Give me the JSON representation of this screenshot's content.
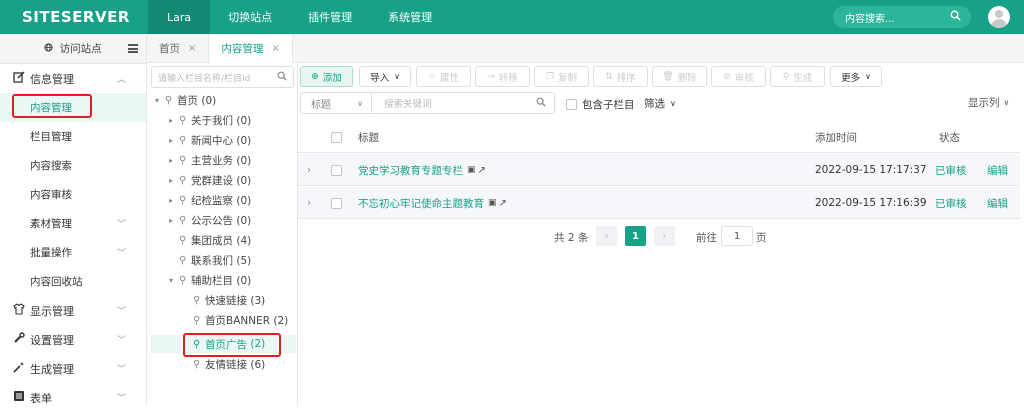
{
  "brand": {
    "logo_text": "SITESERVER"
  },
  "topnav": {
    "items": [
      "Lara",
      "切换站点",
      "插件管理",
      "系统管理"
    ],
    "search_placeholder": "内容搜索..."
  },
  "sidebar": {
    "visit_site": "访问站点",
    "groups": [
      {
        "label": "信息管理",
        "icon": "edit-icon",
        "expanded": true
      },
      {
        "label": "显示管理",
        "icon": "shirt-icon"
      },
      {
        "label": "设置管理",
        "icon": "wrench-icon"
      },
      {
        "label": "生成管理",
        "icon": "magic-wand-icon"
      },
      {
        "label": "表单",
        "icon": "list-icon"
      }
    ],
    "sub_items": [
      "内容管理",
      "栏目管理",
      "内容搜索",
      "内容审核",
      "素材管理",
      "批量操作",
      "内容回收站"
    ]
  },
  "tabs": [
    {
      "label": "首页",
      "close": "×"
    },
    {
      "label": "内容管理",
      "close": "×"
    }
  ],
  "tree": {
    "search_placeholder": "请输入栏目名称/栏目Id",
    "nodes": [
      {
        "label": "首页",
        "count": "(0)"
      },
      {
        "label": "关于我们",
        "count": "(0)"
      },
      {
        "label": "新闻中心",
        "count": "(0)"
      },
      {
        "label": "主营业务",
        "count": "(0)"
      },
      {
        "label": "党群建设",
        "count": "(0)"
      },
      {
        "label": "纪检监察",
        "count": "(0)"
      },
      {
        "label": "公示公告",
        "count": "(0)"
      },
      {
        "label": "集团成员",
        "count": "(4)"
      },
      {
        "label": "联系我们",
        "count": "(5)"
      },
      {
        "label": "辅助栏目",
        "count": "(0)"
      },
      {
        "label": "快速链接",
        "count": "(3)"
      },
      {
        "label": "首页BANNER",
        "count": "(2)"
      },
      {
        "label": "首页广告",
        "count": "(2)"
      },
      {
        "label": "友情链接",
        "count": "(6)"
      }
    ]
  },
  "toolbar": {
    "add": "添加",
    "import": "导入",
    "attributes": "属性",
    "move": "转移",
    "copy": "复制",
    "sort": "排序",
    "delete": "删除",
    "review": "审核",
    "generate": "生成",
    "more": "更多"
  },
  "filter": {
    "field_select": "标题",
    "keyword_placeholder": "搜索关键词",
    "include_children": "包含子栏目",
    "filter_label": "筛选",
    "display_columns": "显示列"
  },
  "table": {
    "headers": {
      "title": "标题",
      "added_time": "添加时间",
      "status": "状态"
    },
    "rows": [
      {
        "title": "党史学习教育专题专栏",
        "time": "2022-09-15 17:17:37",
        "status": "已审核",
        "action": "编辑"
      },
      {
        "title": "不忘初心牢记使命主题教育",
        "time": "2022-09-15 17:16:39",
        "status": "已审核",
        "action": "编辑"
      }
    ]
  },
  "pager": {
    "total": "共 2 条",
    "current_page": "1",
    "goto_label": "前往",
    "goto_value": "1",
    "page_suffix": "页"
  },
  "colors": {
    "accent": "#17a288",
    "highlight": "#e02020"
  }
}
